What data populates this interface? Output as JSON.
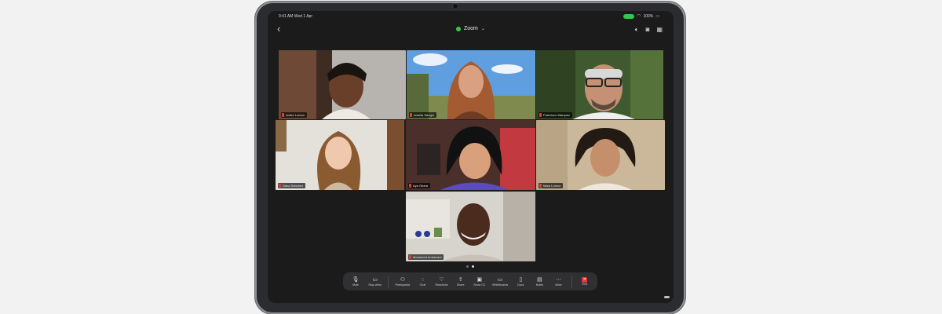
{
  "status": {
    "time_date": "9:41 AM  Wed 1 Apr",
    "battery": "100%"
  },
  "meeting": {
    "title": "Zoom"
  },
  "participants": [
    {
      "name": "Andre Lomco"
    },
    {
      "name": "Amelia Sanger"
    },
    {
      "name": "Francisco Marquez"
    },
    {
      "name": "Dana Sanchez"
    },
    {
      "name": "Aya Ohara"
    },
    {
      "name": "Mara Lomco"
    },
    {
      "name": "Mohamed Ambesani"
    }
  ],
  "toolbar": [
    {
      "label": "Mute",
      "icon": "microphone-icon"
    },
    {
      "label": "Stop video",
      "icon": "video-camera-icon"
    },
    {
      "label": "Participants",
      "icon": "participants-icon"
    },
    {
      "label": "Chat",
      "icon": "chat-icon"
    },
    {
      "label": "Reactions",
      "icon": "heart-icon"
    },
    {
      "label": "Share",
      "icon": "share-icon"
    },
    {
      "label": "Show CC",
      "icon": "captions-icon"
    },
    {
      "label": "Whiteboards",
      "icon": "whiteboard-icon"
    },
    {
      "label": "Docs",
      "icon": "document-icon"
    },
    {
      "label": "Notes",
      "icon": "notes-icon"
    },
    {
      "label": "More",
      "icon": "more-icon"
    },
    {
      "label": "End",
      "icon": "end-icon"
    }
  ],
  "pagination": {
    "pages": 2,
    "current": 2
  },
  "colors": {
    "active_speaker": "#33c24a",
    "end": "#e63b32",
    "battery": "#2fc94b"
  }
}
